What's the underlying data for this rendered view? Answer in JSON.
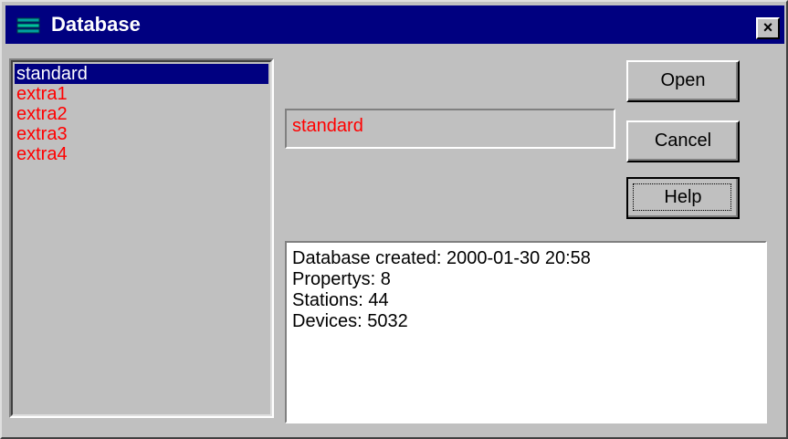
{
  "window": {
    "title": "Database",
    "close_glyph": "×",
    "title_icon": "database-icon"
  },
  "database_list": {
    "items": [
      "standard",
      "extra1",
      "extra2",
      "extra3",
      "extra4"
    ],
    "selected_index": 0
  },
  "name_field": {
    "value": "standard"
  },
  "buttons": {
    "open": "Open",
    "cancel": "Cancel",
    "help": "Help"
  },
  "info": {
    "lines": [
      "Database created: 2000-01-30 20:58",
      "Propertys: 8",
      "Stations: 44",
      "Devices: 5032"
    ]
  },
  "colors": {
    "titlebar": "#000080",
    "selection": "#000080",
    "list_text": "#ff0000",
    "face": "#c0c0c0"
  }
}
